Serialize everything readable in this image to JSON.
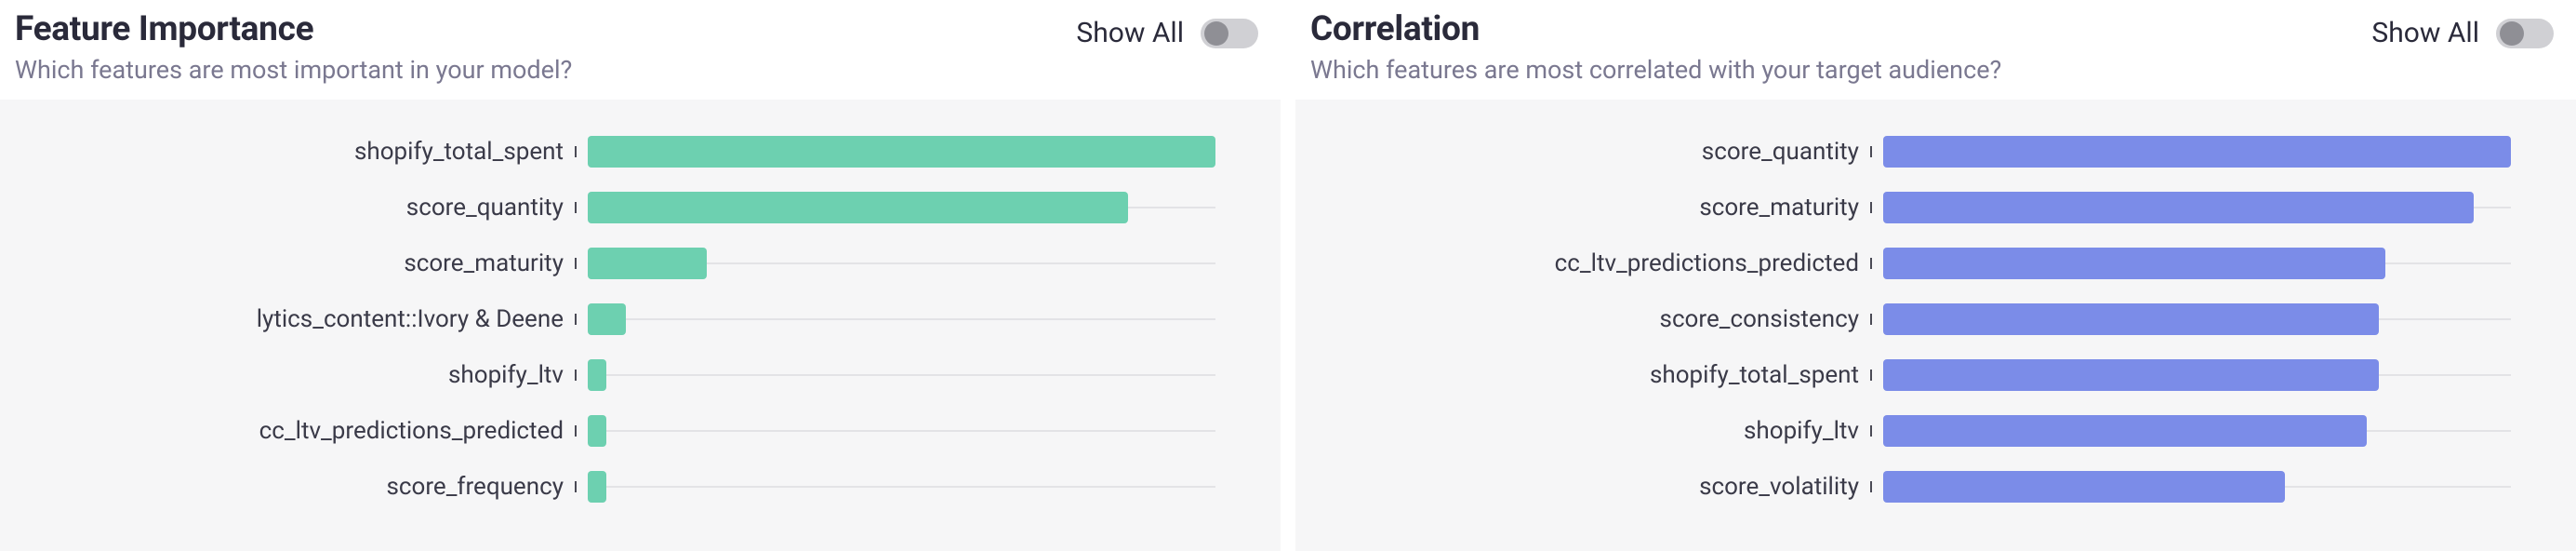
{
  "panels": [
    {
      "id": "feature-importance",
      "title": "Feature Importance",
      "subtitle": "Which features are most important in your model?",
      "toggle_label": "Show All",
      "color_class": "green"
    },
    {
      "id": "correlation",
      "title": "Correlation",
      "subtitle": "Which features are most correlated with your target audience?",
      "toggle_label": "Show All",
      "color_class": "blue"
    }
  ],
  "chart_data": [
    {
      "type": "bar",
      "title": "Feature Importance",
      "xlabel": "",
      "ylabel": "",
      "xlim": [
        0,
        100
      ],
      "categories": [
        "shopify_total_spent",
        "score_quantity",
        "score_maturity",
        "lytics_content::Ivory & Deene",
        "shopify_ltv",
        "cc_ltv_predictions_predicted",
        "score_frequency"
      ],
      "values": [
        100,
        86,
        19,
        6,
        3,
        3,
        3
      ]
    },
    {
      "type": "bar",
      "title": "Correlation",
      "xlabel": "",
      "ylabel": "",
      "xlim": [
        0,
        100
      ],
      "categories": [
        "score_quantity",
        "score_maturity",
        "cc_ltv_predictions_predicted",
        "score_consistency",
        "shopify_total_spent",
        "shopify_ltv",
        "score_volatility"
      ],
      "values": [
        100,
        94,
        80,
        79,
        79,
        77,
        64
      ]
    }
  ]
}
